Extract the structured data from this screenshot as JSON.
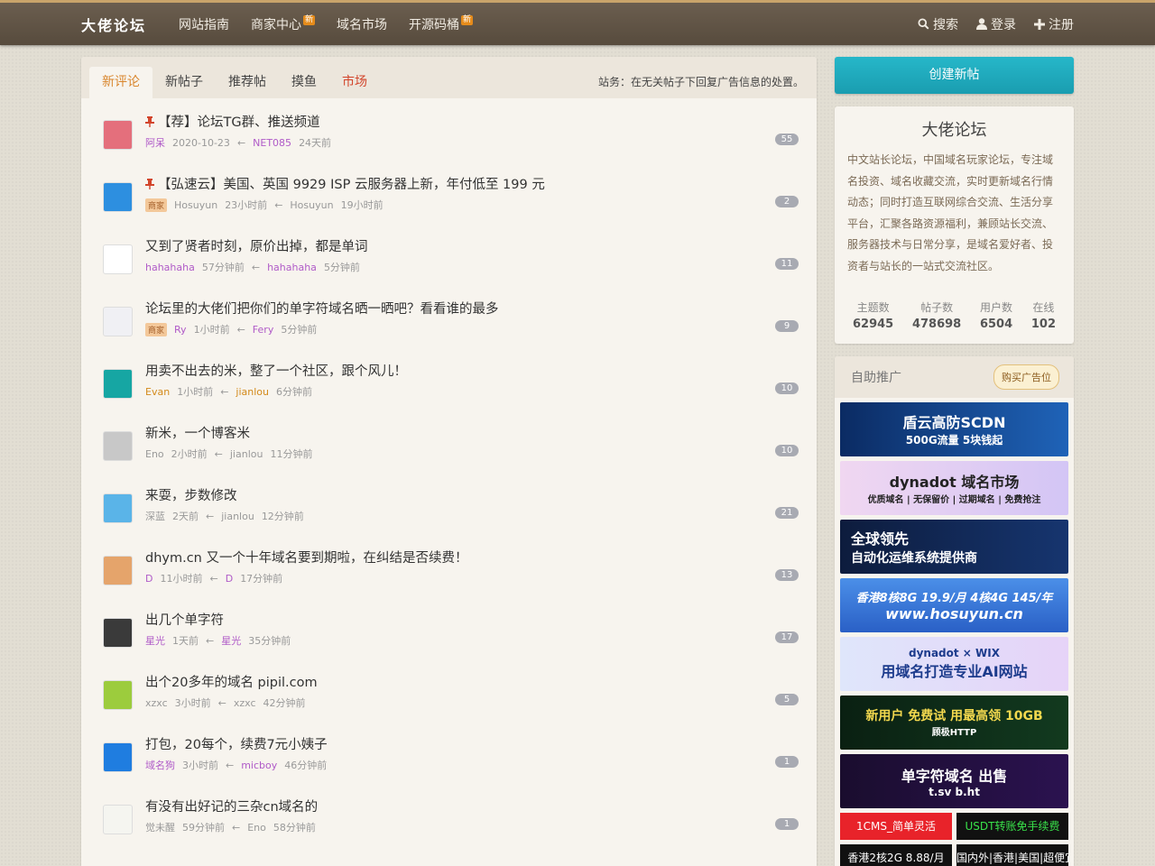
{
  "nav": {
    "logo": "大佬论坛",
    "items": [
      {
        "label": "网站指南",
        "new": false
      },
      {
        "label": "商家中心",
        "new": true
      },
      {
        "label": "域名市场",
        "new": false
      },
      {
        "label": "开源码桶",
        "new": true
      }
    ],
    "new_badge": "新",
    "search": "搜索",
    "login": "登录",
    "register": "注册"
  },
  "tabs": {
    "items": [
      "新评论",
      "新帖子",
      "推荐帖",
      "摸鱼",
      "市场"
    ],
    "notice": "站务：在无关帖子下回复广告信息的处置。"
  },
  "merchant_label": "商家",
  "arrow": "←",
  "topics": [
    {
      "title": "【荐】论坛TG群、推送频道",
      "pinned": true,
      "author": "阿呆",
      "time": "2020-10-23",
      "last_user": "NET085",
      "last_time": "24天前",
      "count": "55"
    },
    {
      "title": "【弘速云】美国、英国 9929 ISP 云服务器上新，年付低至 199 元",
      "pinned": true,
      "merchant": true,
      "author": "Hosuyun",
      "time": "23小时前",
      "last_user": "Hosuyun",
      "last_time": "19小时前",
      "count": "2"
    },
    {
      "title": "又到了贤者时刻，原价出掉，都是单词",
      "author": "hahahaha",
      "time": "57分钟前",
      "last_user": "hahahaha",
      "last_time": "5分钟前",
      "count": "11"
    },
    {
      "title": "论坛里的大佬们把你们的单字符域名晒一晒吧？看看谁的最多",
      "merchant": true,
      "author": "Ry",
      "time": "1小时前",
      "last_user": "Fery",
      "last_time": "5分钟前",
      "count": "9"
    },
    {
      "title": "用卖不出去的米，整了一个社区，跟个风儿！",
      "author": "Evan",
      "time": "1小时前",
      "last_user": "jianlou",
      "last_time": "6分钟前",
      "count": "10"
    },
    {
      "title": "新米，一个博客米",
      "author": "Eno",
      "time": "2小时前",
      "last_user": "jianlou",
      "last_time": "11分钟前",
      "count": "10"
    },
    {
      "title": "来耍，步数修改",
      "author": "深蓝",
      "time": "2天前",
      "last_user": "jianlou",
      "last_time": "12分钟前",
      "count": "21"
    },
    {
      "title": "dhym.cn 又一个十年域名要到期啦，在纠结是否续费！",
      "author": "D",
      "time": "11小时前",
      "last_user": "D",
      "last_time": "17分钟前",
      "count": "13"
    },
    {
      "title": "出几个单字符",
      "author": "星光",
      "time": "1天前",
      "last_user": "星光",
      "last_time": "35分钟前",
      "count": "17"
    },
    {
      "title": "出个20多年的域名 pipil.com",
      "author": "xzxc",
      "time": "3小时前",
      "last_user": "xzxc",
      "last_time": "42分钟前",
      "count": "5"
    },
    {
      "title": "打包，20每个，续费7元小姨子",
      "author": "域名狗",
      "time": "3小时前",
      "last_user": "micboy",
      "last_time": "46分钟前",
      "count": "1"
    },
    {
      "title": "有没有出好记的三杂cn域名的",
      "author": "觉未醒",
      "time": "59分钟前",
      "last_user": "Eno",
      "last_time": "58分钟前",
      "count": "1"
    }
  ],
  "sidebar": {
    "create_button": "创建新帖",
    "title": "大佬论坛",
    "description": "中文站长论坛，中国域名玩家论坛，专注域名投资、域名收藏交流，实时更新域名行情动态；同时打造互联网综合交流、生活分享平台，汇聚各路资源福利，兼顾站长交流、服务器技术与日常分享，是域名爱好者、投资者与站长的一站式交流社区。",
    "stats": [
      {
        "label": "主题数",
        "value": "62945"
      },
      {
        "label": "帖子数",
        "value": "478698"
      },
      {
        "label": "用户数",
        "value": "6504"
      },
      {
        "label": "在线",
        "value": "102"
      }
    ],
    "promo_title": "自助推广",
    "buy_ad": "购买广告位",
    "ads": [
      {
        "line1": "盾云高防SCDN",
        "line2": "500G流量 5块钱起"
      },
      {
        "line1": "dynadot 域名市场",
        "line2": "优质域名 | 无保留价 | 过期域名 | 免费抢注"
      },
      {
        "line1": "全球领先",
        "line2": "自动化运维系统提供商"
      },
      {
        "line1": "香港8核8G 19.9/月 4核4G 145/年",
        "line2": "www.hosuyun.cn"
      },
      {
        "line1": "dynadot × WIX",
        "line2": "用域名打造专业AI网站"
      },
      {
        "line1": "新用户 免费试 用最高领 10GB",
        "line2": "顾极HTTP"
      },
      {
        "line1": "单字符域名 出售",
        "line2": "t.sv  b.ht"
      }
    ],
    "text_ads": [
      {
        "label": "1CMS_简单灵活",
        "bg": "#e8232a",
        "color": "#ffffff"
      },
      {
        "label": "USDT转账免手续费",
        "bg": "#111111",
        "color": "#39e04a"
      },
      {
        "label": "香港2核2G 8.88/月",
        "bg": "#111111",
        "color": "#ffffff"
      },
      {
        "label": "国内外|香港|美国|超便宜",
        "bg": "#111111",
        "color": "#ffffff"
      }
    ]
  }
}
